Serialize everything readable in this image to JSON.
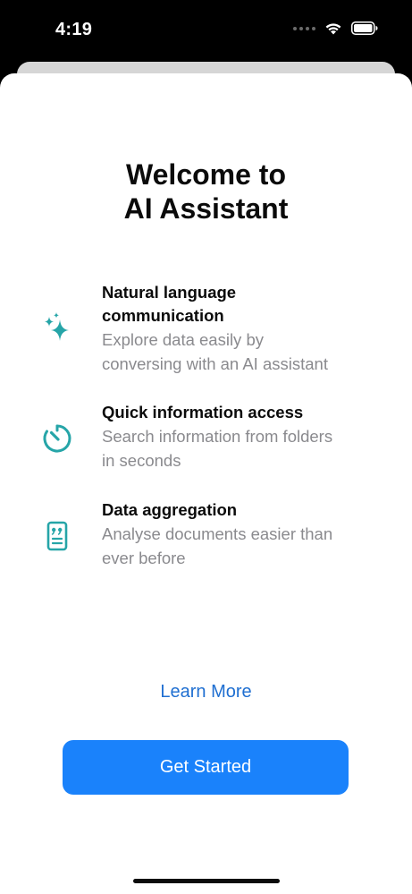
{
  "status_bar": {
    "time": "4:19"
  },
  "welcome": {
    "title_line1": "Welcome to",
    "title_line2": "AI Assistant"
  },
  "features": [
    {
      "icon": "sparkles-icon",
      "title_line1": "Natural language",
      "title_line2": "communication",
      "desc_line1": "Explore data easily by",
      "desc_line2": "conversing with an AI assistant"
    },
    {
      "icon": "timer-icon",
      "title_line1": "Quick information access",
      "desc_line1": "Search information from folders",
      "desc_line2": "in seconds"
    },
    {
      "icon": "quote-document-icon",
      "title_line1": "Data aggregation",
      "desc_line1": "Analyse documents easier than",
      "desc_line2": "ever before"
    }
  ],
  "actions": {
    "learn_more": "Learn More",
    "get_started": "Get Started"
  },
  "colors": {
    "accent": "#1a82fb",
    "link": "#1f6fd1",
    "icon_teal": "#26a5a8",
    "secondary_text": "#8a8a8e"
  }
}
